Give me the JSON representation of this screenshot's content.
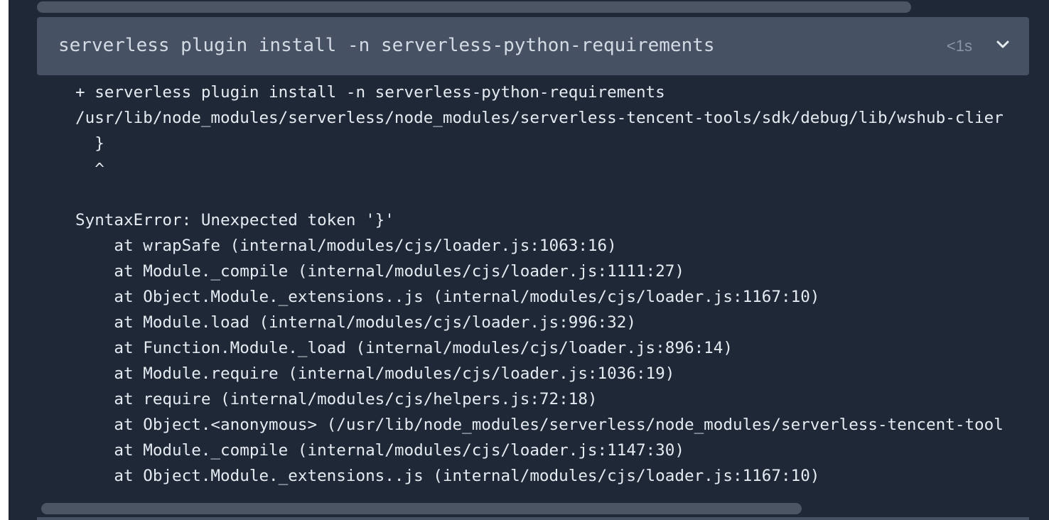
{
  "step": {
    "title": "serverless plugin install -n serverless-python-requirements",
    "duration": "<1s",
    "toggle_icon": "chevron-down-icon"
  },
  "log": {
    "lines": [
      "+ serverless plugin install -n serverless-python-requirements",
      "/usr/lib/node_modules/serverless/node_modules/serverless-tencent-tools/sdk/debug/lib/wshub-clier",
      "  }",
      "  ^",
      "",
      "SyntaxError: Unexpected token '}'",
      "    at wrapSafe (internal/modules/cjs/loader.js:1063:16)",
      "    at Module._compile (internal/modules/cjs/loader.js:1111:27)",
      "    at Object.Module._extensions..js (internal/modules/cjs/loader.js:1167:10)",
      "    at Module.load (internal/modules/cjs/loader.js:996:32)",
      "    at Function.Module._load (internal/modules/cjs/loader.js:896:14)",
      "    at Module.require (internal/modules/cjs/loader.js:1036:19)",
      "    at require (internal/modules/cjs/helpers.js:72:18)",
      "    at Object.<anonymous> (/usr/lib/node_modules/serverless/node_modules/serverless-tencent-tool",
      "    at Module._compile (internal/modules/cjs/loader.js:1147:30)",
      "    at Object.Module._extensions..js (internal/modules/cjs/loader.js:1167:10)"
    ]
  },
  "colors": {
    "background": "#1f2837",
    "header": "#465263",
    "text": "#e6ebf2",
    "muted": "#8a96a8",
    "scrollbar": "#4b5563"
  }
}
